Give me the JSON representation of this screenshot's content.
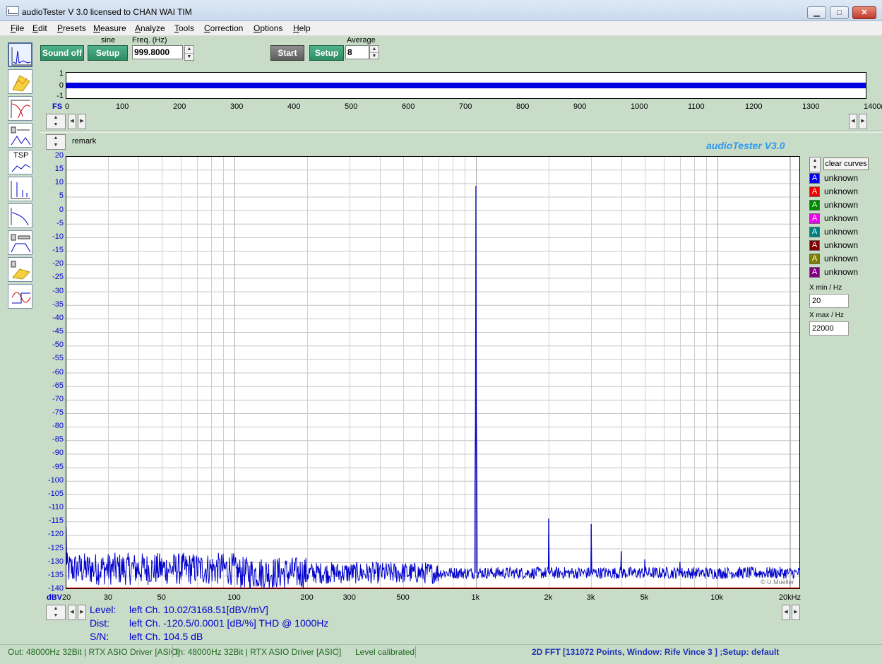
{
  "window": {
    "title": "audioTester  V 3.0   licensed to CHAN WAI TIM",
    "min": "▁",
    "max": "□",
    "close": "✕"
  },
  "menu": [
    "File",
    "Edit",
    "Presets",
    "Measure",
    "Analyze",
    "Tools",
    "Correction",
    "Options",
    "Help"
  ],
  "sidebar": {
    "tsp_label": "TSP"
  },
  "toolbar": {
    "sound_off": "Sound off",
    "sine_label": "sine",
    "setup1": "Setup",
    "freq_label": "Freq. (Hz)",
    "freq_value": "999.8000",
    "start": "Start",
    "setup2": "Setup",
    "average_label": "Average",
    "average_value": "8"
  },
  "scope": {
    "y_ticks": [
      "1",
      "0",
      "-1"
    ],
    "x_prefix": "FS",
    "x_ticks": [
      "0",
      "100",
      "200",
      "300",
      "400",
      "500",
      "600",
      "700",
      "800",
      "900",
      "1000",
      "1100",
      "1200",
      "1300",
      "1400m"
    ]
  },
  "plot": {
    "remark": "remark",
    "brand": "audioTester  V3.0",
    "y_unit": "dBV",
    "copyright": "© U.Mueller",
    "x_ticks": [
      {
        "f": 20,
        "label": "20"
      },
      {
        "f": 30,
        "label": "30"
      },
      {
        "f": 50,
        "label": "50"
      },
      {
        "f": 100,
        "label": "100"
      },
      {
        "f": 200,
        "label": "200"
      },
      {
        "f": 300,
        "label": "300"
      },
      {
        "f": 500,
        "label": "500"
      },
      {
        "f": 1000,
        "label": "1k"
      },
      {
        "f": 2000,
        "label": "2k"
      },
      {
        "f": 3000,
        "label": "3k"
      },
      {
        "f": 5000,
        "label": "5k"
      },
      {
        "f": 10000,
        "label": "10k"
      },
      {
        "f": 20000,
        "label": "20kHz"
      }
    ]
  },
  "chart_data": {
    "type": "line",
    "title": "",
    "xlabel": "",
    "ylabel": "dBV",
    "x_scale": "log",
    "xlim": [
      20,
      22000
    ],
    "ylim": [
      -140,
      20
    ],
    "y_ticks": [
      20,
      15,
      10,
      5,
      0,
      -5,
      -10,
      -15,
      -20,
      -25,
      -30,
      -35,
      -40,
      -45,
      -50,
      -55,
      -60,
      -65,
      -70,
      -75,
      -80,
      -85,
      -90,
      -95,
      -100,
      -105,
      -110,
      -115,
      -120,
      -125,
      -130,
      -135,
      -140
    ],
    "grid": true,
    "series": [
      {
        "color": "#0000cc",
        "noise_floor_db": -134,
        "peaks": [
          {
            "x": 20,
            "y": -117
          },
          {
            "x": 1000,
            "y": 9
          },
          {
            "x": 2000,
            "y": -114
          },
          {
            "x": 3000,
            "y": -116
          },
          {
            "x": 4000,
            "y": -126
          },
          {
            "x": 5000,
            "y": -129
          },
          {
            "x": 7000,
            "y": -130
          }
        ]
      }
    ]
  },
  "legend": {
    "clear_curves": "clear curves",
    "items": [
      {
        "label": "unknown",
        "color": "#0000ee"
      },
      {
        "label": "unknown",
        "color": "#ee0000"
      },
      {
        "label": "unknown",
        "color": "#008800"
      },
      {
        "label": "unknown",
        "color": "#ee00ee"
      },
      {
        "label": "unknown",
        "color": "#008080"
      },
      {
        "label": "unknown",
        "color": "#800000"
      },
      {
        "label": "unknown",
        "color": "#808000"
      },
      {
        "label": "unknown",
        "color": "#800080"
      }
    ],
    "glyph": "A",
    "xmin_label": "X min / Hz",
    "xmin_value": "20",
    "xmax_label": "X max / Hz",
    "xmax_value": "22000"
  },
  "readouts": [
    {
      "key": "Level:",
      "value": "left Ch. 10.02/3168.51[dBV/mV]"
    },
    {
      "key": "Dist:",
      "value": "left Ch. -120.5/0.0001 [dB/%] THD @ 1000Hz"
    },
    {
      "key": "S/N:",
      "value": "left Ch. 104.5 dB"
    }
  ],
  "status": {
    "out": "Out: 48000Hz 32Bit  | RTX ASIO Driver [ASIO]",
    "in": "In: 48000Hz 32Bit  | RTX ASIO Driver [ASIO]",
    "level": "Level calibrated",
    "main": "2D FFT [131072 Points, Window: Rife Vince 3 ]  ;Setup:  default"
  }
}
